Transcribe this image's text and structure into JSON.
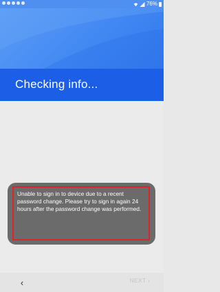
{
  "status_bar": {
    "battery_text": "76%",
    "signal_icon": "signal-icon",
    "battery_icon": "battery-icon"
  },
  "header": {
    "title": "Checking info..."
  },
  "toast": {
    "message": "Unable to sign in to device due to a recent password change. Please try to sign in again 24 hours after the password change was performed."
  },
  "navigation": {
    "back_label": "‹",
    "next_label": "NEXT ›"
  },
  "colors": {
    "header_band": "#1c5fe6",
    "header_bg": "#4f8ff0",
    "toast_bg": "#6b6b6b",
    "highlight_border": "#d8262a"
  }
}
